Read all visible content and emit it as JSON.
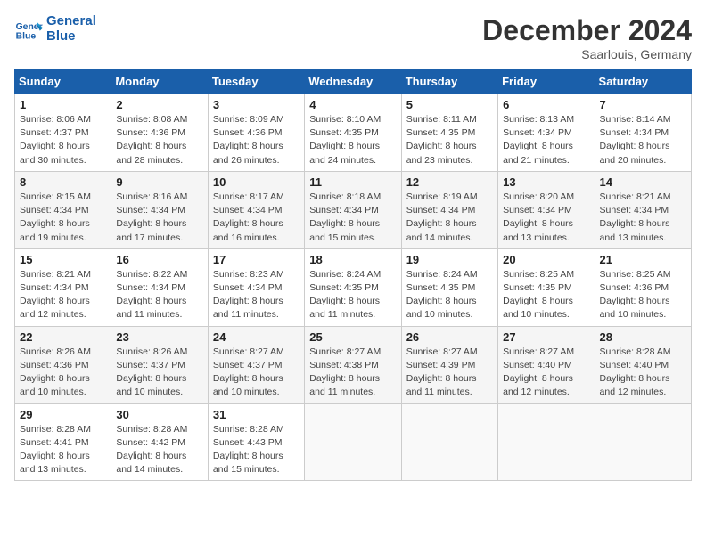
{
  "header": {
    "logo_line1": "General",
    "logo_line2": "Blue",
    "month_year": "December 2024",
    "location": "Saarlouis, Germany"
  },
  "weekdays": [
    "Sunday",
    "Monday",
    "Tuesday",
    "Wednesday",
    "Thursday",
    "Friday",
    "Saturday"
  ],
  "weeks": [
    [
      {
        "day": "1",
        "sunrise": "8:06 AM",
        "sunset": "4:37 PM",
        "daylight": "8 hours and 30 minutes."
      },
      {
        "day": "2",
        "sunrise": "8:08 AM",
        "sunset": "4:36 PM",
        "daylight": "8 hours and 28 minutes."
      },
      {
        "day": "3",
        "sunrise": "8:09 AM",
        "sunset": "4:36 PM",
        "daylight": "8 hours and 26 minutes."
      },
      {
        "day": "4",
        "sunrise": "8:10 AM",
        "sunset": "4:35 PM",
        "daylight": "8 hours and 24 minutes."
      },
      {
        "day": "5",
        "sunrise": "8:11 AM",
        "sunset": "4:35 PM",
        "daylight": "8 hours and 23 minutes."
      },
      {
        "day": "6",
        "sunrise": "8:13 AM",
        "sunset": "4:34 PM",
        "daylight": "8 hours and 21 minutes."
      },
      {
        "day": "7",
        "sunrise": "8:14 AM",
        "sunset": "4:34 PM",
        "daylight": "8 hours and 20 minutes."
      }
    ],
    [
      {
        "day": "8",
        "sunrise": "8:15 AM",
        "sunset": "4:34 PM",
        "daylight": "8 hours and 19 minutes."
      },
      {
        "day": "9",
        "sunrise": "8:16 AM",
        "sunset": "4:34 PM",
        "daylight": "8 hours and 17 minutes."
      },
      {
        "day": "10",
        "sunrise": "8:17 AM",
        "sunset": "4:34 PM",
        "daylight": "8 hours and 16 minutes."
      },
      {
        "day": "11",
        "sunrise": "8:18 AM",
        "sunset": "4:34 PM",
        "daylight": "8 hours and 15 minutes."
      },
      {
        "day": "12",
        "sunrise": "8:19 AM",
        "sunset": "4:34 PM",
        "daylight": "8 hours and 14 minutes."
      },
      {
        "day": "13",
        "sunrise": "8:20 AM",
        "sunset": "4:34 PM",
        "daylight": "8 hours and 13 minutes."
      },
      {
        "day": "14",
        "sunrise": "8:21 AM",
        "sunset": "4:34 PM",
        "daylight": "8 hours and 13 minutes."
      }
    ],
    [
      {
        "day": "15",
        "sunrise": "8:21 AM",
        "sunset": "4:34 PM",
        "daylight": "8 hours and 12 minutes."
      },
      {
        "day": "16",
        "sunrise": "8:22 AM",
        "sunset": "4:34 PM",
        "daylight": "8 hours and 11 minutes."
      },
      {
        "day": "17",
        "sunrise": "8:23 AM",
        "sunset": "4:34 PM",
        "daylight": "8 hours and 11 minutes."
      },
      {
        "day": "18",
        "sunrise": "8:24 AM",
        "sunset": "4:35 PM",
        "daylight": "8 hours and 11 minutes."
      },
      {
        "day": "19",
        "sunrise": "8:24 AM",
        "sunset": "4:35 PM",
        "daylight": "8 hours and 10 minutes."
      },
      {
        "day": "20",
        "sunrise": "8:25 AM",
        "sunset": "4:35 PM",
        "daylight": "8 hours and 10 minutes."
      },
      {
        "day": "21",
        "sunrise": "8:25 AM",
        "sunset": "4:36 PM",
        "daylight": "8 hours and 10 minutes."
      }
    ],
    [
      {
        "day": "22",
        "sunrise": "8:26 AM",
        "sunset": "4:36 PM",
        "daylight": "8 hours and 10 minutes."
      },
      {
        "day": "23",
        "sunrise": "8:26 AM",
        "sunset": "4:37 PM",
        "daylight": "8 hours and 10 minutes."
      },
      {
        "day": "24",
        "sunrise": "8:27 AM",
        "sunset": "4:37 PM",
        "daylight": "8 hours and 10 minutes."
      },
      {
        "day": "25",
        "sunrise": "8:27 AM",
        "sunset": "4:38 PM",
        "daylight": "8 hours and 11 minutes."
      },
      {
        "day": "26",
        "sunrise": "8:27 AM",
        "sunset": "4:39 PM",
        "daylight": "8 hours and 11 minutes."
      },
      {
        "day": "27",
        "sunrise": "8:27 AM",
        "sunset": "4:40 PM",
        "daylight": "8 hours and 12 minutes."
      },
      {
        "day": "28",
        "sunrise": "8:28 AM",
        "sunset": "4:40 PM",
        "daylight": "8 hours and 12 minutes."
      }
    ],
    [
      {
        "day": "29",
        "sunrise": "8:28 AM",
        "sunset": "4:41 PM",
        "daylight": "8 hours and 13 minutes."
      },
      {
        "day": "30",
        "sunrise": "8:28 AM",
        "sunset": "4:42 PM",
        "daylight": "8 hours and 14 minutes."
      },
      {
        "day": "31",
        "sunrise": "8:28 AM",
        "sunset": "4:43 PM",
        "daylight": "8 hours and 15 minutes."
      },
      null,
      null,
      null,
      null
    ]
  ]
}
